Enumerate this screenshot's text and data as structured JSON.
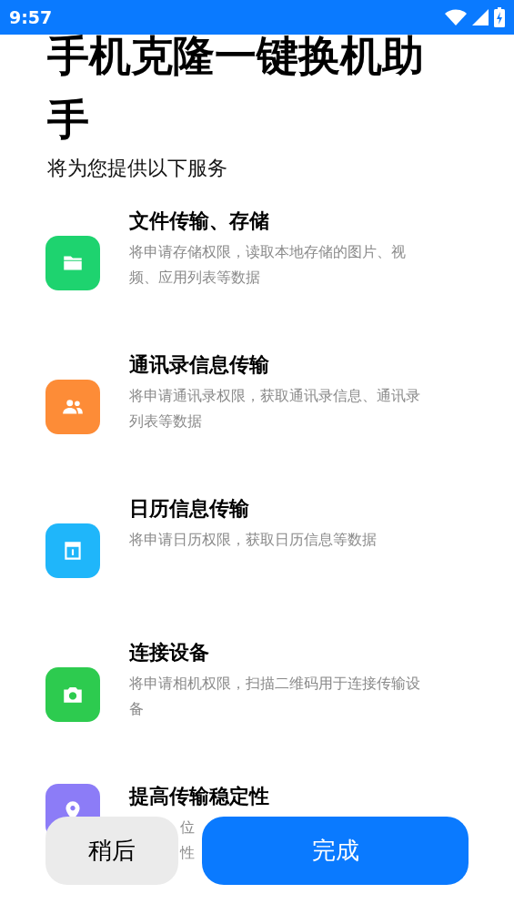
{
  "status_bar": {
    "time": "9:57"
  },
  "title": "手机克隆一键换机助手",
  "subtitle": "将为您提供以下服务",
  "services": [
    {
      "kind": "folder",
      "color": "#1ed36f",
      "title": "文件传输、存储",
      "description": "将申请存储权限，读取本地存储的图片、视频、应用列表等数据"
    },
    {
      "kind": "contacts",
      "color": "#fd8c37",
      "title": "通讯录信息传输",
      "description": "将申请通讯录权限，获取通讯录信息、通讯录列表等数据"
    },
    {
      "kind": "calendar",
      "color": "#1fb6fa",
      "title": "日历信息传输",
      "description": "将申请日历权限，获取日历信息等数据"
    },
    {
      "kind": "camera",
      "color": "#2dcb4f",
      "title": "连接设备",
      "description": "将申请相机权限，扫描二维码用于连接传输设备"
    },
    {
      "kind": "location",
      "color": "#8c7cf7",
      "title": "提高传输稳定性",
      "fragments": [
        "位",
        "性"
      ]
    }
  ],
  "buttons": {
    "later": "稍后",
    "done": "完成"
  }
}
